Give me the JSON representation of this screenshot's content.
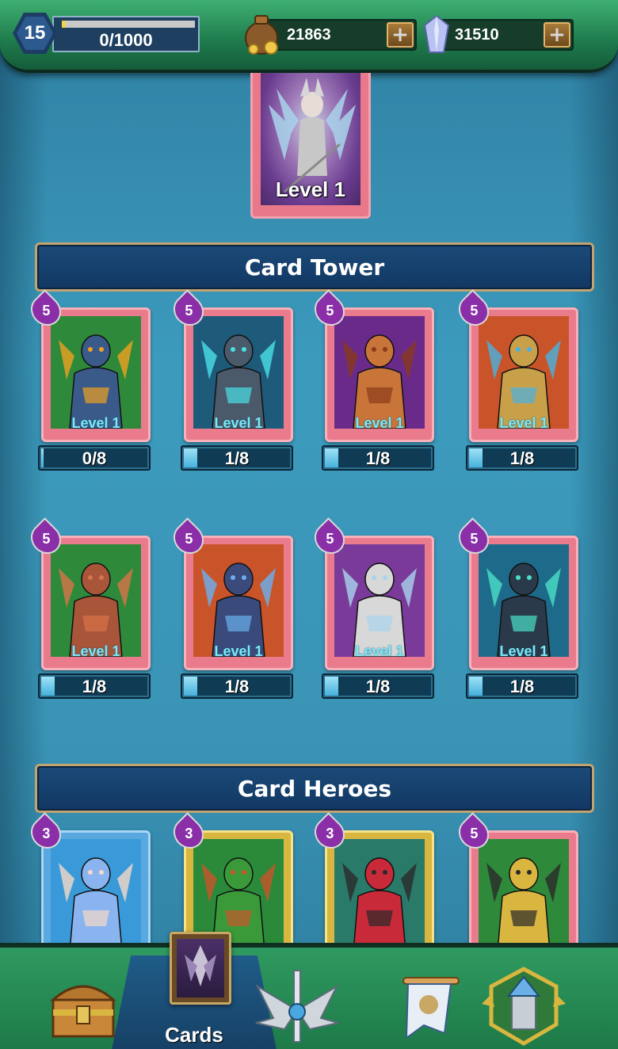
{
  "hud": {
    "player_level": "15",
    "xp_text": "0/1000",
    "xp_progress": 0.03,
    "gold": "21863",
    "gems": "31510",
    "gold_icon": "gold-sack-icon",
    "gem_icon": "crystal-icon",
    "plus_icon": "plus-icon"
  },
  "featured_card": {
    "level_label": "Level 1"
  },
  "sections": {
    "tower_title": "Card Tower",
    "heroes_title": "Card Heroes"
  },
  "tower_cards": [
    {
      "rank": "5",
      "level": "Level 1",
      "progress_text": "0/8",
      "progress": 0.0,
      "frame": "pink",
      "art": "dragon"
    },
    {
      "rank": "5",
      "level": "Level 1",
      "progress_text": "1/8",
      "progress": 0.125,
      "frame": "pink",
      "art": "golem"
    },
    {
      "rank": "5",
      "level": "Level 1",
      "progress_text": "1/8",
      "progress": 0.125,
      "frame": "pink",
      "art": "witch"
    },
    {
      "rank": "5",
      "level": "Level 1",
      "progress_text": "1/8",
      "progress": 0.125,
      "frame": "pink",
      "art": "knight"
    },
    {
      "rank": "5",
      "level": "Level 1",
      "progress_text": "1/8",
      "progress": 0.125,
      "frame": "pink",
      "art": "rock-giant"
    },
    {
      "rank": "5",
      "level": "Level 1",
      "progress_text": "1/8",
      "progress": 0.125,
      "frame": "pink",
      "art": "ogre"
    },
    {
      "rank": "5",
      "level": "Level 1",
      "progress_text": "1/8",
      "progress": 0.125,
      "frame": "pink",
      "art": "valkyrie"
    },
    {
      "rank": "5",
      "level": "Level 1",
      "progress_text": "1/8",
      "progress": 0.125,
      "frame": "pink",
      "art": "dark-knight"
    }
  ],
  "hero_cards": [
    {
      "rank": "3",
      "frame": "blue",
      "art": "blue-hair-girl"
    },
    {
      "rank": "3",
      "frame": "gold",
      "art": "green-orc"
    },
    {
      "rank": "3",
      "frame": "gold",
      "art": "red-robots"
    },
    {
      "rank": "5",
      "frame": "pink",
      "art": "bearded-warrior"
    }
  ],
  "bottom_nav": {
    "items": [
      {
        "icon": "treasure-chest-icon"
      },
      {
        "icon": "cards-icon",
        "label": "Cards"
      },
      {
        "icon": "winged-sword-icon"
      },
      {
        "icon": "banner-flag-icon"
      },
      {
        "icon": "tower-crest-icon"
      }
    ]
  },
  "colors": {
    "hud_green": "#1e7a4c",
    "banner_blue": "#1b4a78",
    "frame_pink": "#ea7b8c",
    "rank_purple": "#8a2fa8",
    "level_cyan": "#7ce8f5"
  }
}
